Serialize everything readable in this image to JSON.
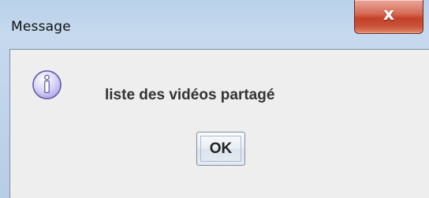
{
  "window": {
    "title": "Message",
    "close_glyph": "x"
  },
  "dialog": {
    "icon": "info-icon",
    "message": "liste des vidéos partagé",
    "ok_label": "OK"
  },
  "colors": {
    "titlebar": "#b9d1ea",
    "close_button": "#c4412a",
    "content_background": "#eeeeee",
    "icon_fill": "#c8c3ef",
    "icon_border": "#5e58a8",
    "text": "#333333"
  }
}
